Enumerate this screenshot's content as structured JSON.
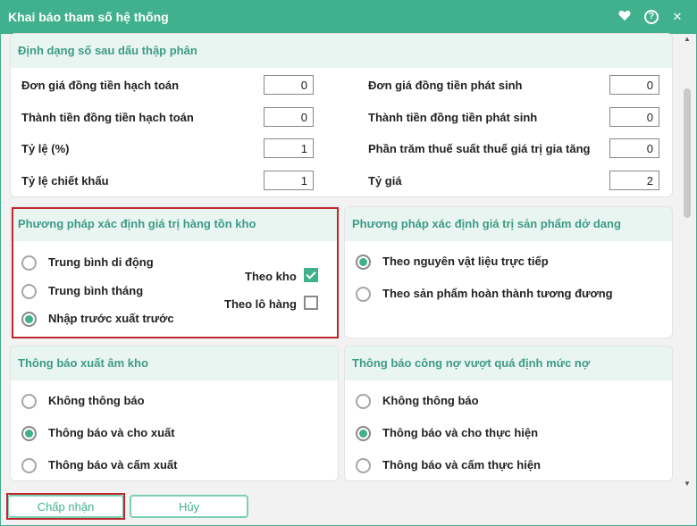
{
  "window": {
    "title": "Khai báo tham số hệ thống",
    "favorite_icon": "heart-icon",
    "help_icon": "help-icon",
    "close_icon": "close-icon",
    "help_glyph": "?",
    "close_glyph": "✕"
  },
  "decimal_section": {
    "header": "Định dạng số sau dấu thập phân",
    "fields": [
      {
        "label": "Đơn giá đồng tiền hạch toán",
        "value": "0"
      },
      {
        "label": "Đơn giá đồng tiền phát sinh",
        "value": "0"
      },
      {
        "label": "Thành tiền đồng tiền hạch toán",
        "value": "0"
      },
      {
        "label": "Thành tiền đồng tiền phát sinh",
        "value": "0"
      },
      {
        "label": "Tỷ lệ (%)",
        "value": "1"
      },
      {
        "label": "Phần trăm thuế suất thuế giá trị gia tăng",
        "value": "0"
      },
      {
        "label": "Tỷ lệ chiết khấu",
        "value": "1"
      },
      {
        "label": "Tỷ giá",
        "value": "2"
      }
    ]
  },
  "inventory_method": {
    "header": "Phương pháp xác định giá trị hàng tồn kho",
    "options": [
      {
        "label": "Trung bình di động",
        "checked": false
      },
      {
        "label": "Trung bình tháng",
        "checked": false
      },
      {
        "label": "Nhập trước xuất trước",
        "checked": true
      }
    ],
    "checks": [
      {
        "label": "Theo kho",
        "checked": true
      },
      {
        "label": "Theo lô hàng",
        "checked": false
      }
    ]
  },
  "wip_method": {
    "header": "Phương pháp xác định giá trị sản phẩm dở dang",
    "options": [
      {
        "label": "Theo nguyên vật liệu trực tiếp",
        "checked": true
      },
      {
        "label": "Theo sản phẩm hoàn thành tương đương",
        "checked": false
      }
    ]
  },
  "negative_stock": {
    "header": "Thông báo xuất âm kho",
    "options": [
      {
        "label": "Không thông báo",
        "checked": false
      },
      {
        "label": "Thông báo và cho xuất",
        "checked": true
      },
      {
        "label": "Thông báo và cấm xuất",
        "checked": false
      }
    ]
  },
  "debt_limit": {
    "header": "Thông báo công nợ vượt quá định mức nợ",
    "options": [
      {
        "label": "Không thông báo",
        "checked": false
      },
      {
        "label": "Thông báo và cho thực hiện",
        "checked": true
      },
      {
        "label": "Thông báo và cấm thực hiện",
        "checked": false
      }
    ]
  },
  "footer": {
    "accept_label": "Chấp nhận",
    "cancel_label": "Hủy"
  },
  "colors": {
    "accent": "#41b18d",
    "header_bg": "#e9f5f1",
    "highlight": "#c0272d"
  }
}
